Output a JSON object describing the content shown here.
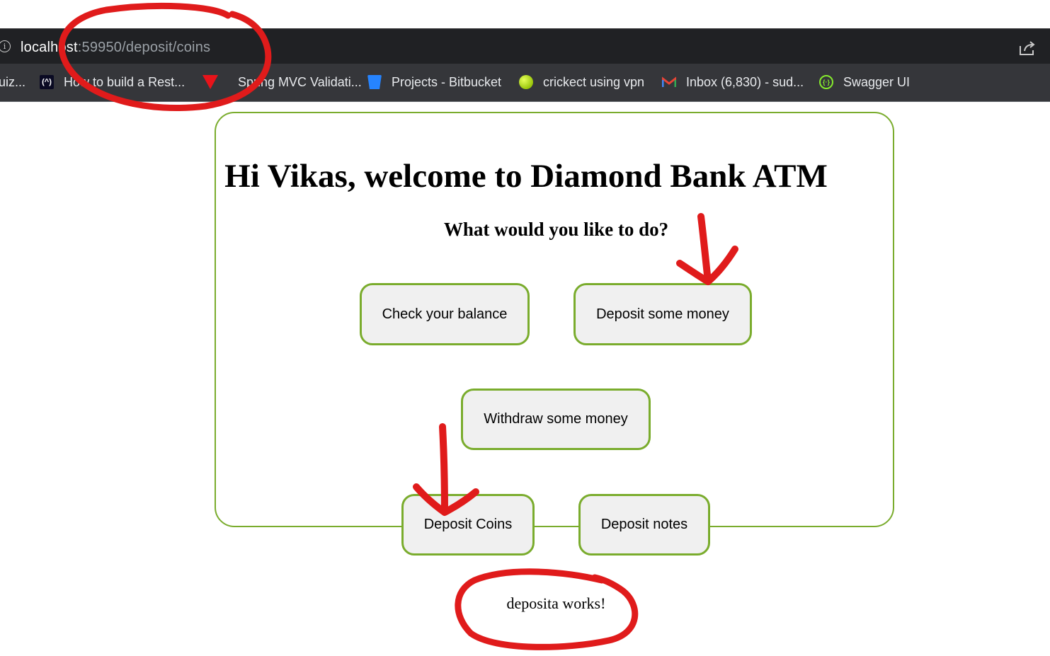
{
  "browser": {
    "url_host": "localhost",
    "url_path": ":59950/deposit/coins",
    "bookmarks": [
      {
        "icon": "quiz-icon",
        "label": "uiz..."
      },
      {
        "icon": "freecodecamp-icon",
        "label": "How to build a Rest..."
      },
      {
        "icon": "spring-icon",
        "label": "Spring MVC Validati..."
      },
      {
        "icon": "bitbucket-icon",
        "label": "Projects - Bitbucket"
      },
      {
        "icon": "tennis-ball-icon",
        "label": "crickect using vpn"
      },
      {
        "icon": "gmail-icon",
        "label": "Inbox (6,830) - sud..."
      },
      {
        "icon": "swagger-icon",
        "label": "Swagger UI"
      }
    ]
  },
  "page": {
    "title": "Hi Vikas, welcome to Diamond Bank ATM",
    "subtitle": "What would you like to do?",
    "buttons": {
      "check_balance": "Check your balance",
      "deposit_money": "Deposit some money",
      "withdraw_money": "Withdraw some money",
      "deposit_coins": "Deposit Coins",
      "deposit_notes": "Deposit notes"
    },
    "status": "deposita works!"
  },
  "colors": {
    "accent_border": "#7aac2d",
    "button_bg": "#f0f0f0",
    "annotation_red": "#e01b1b",
    "urlbar_bg": "#202124",
    "bookmarks_bg": "#35363a"
  }
}
